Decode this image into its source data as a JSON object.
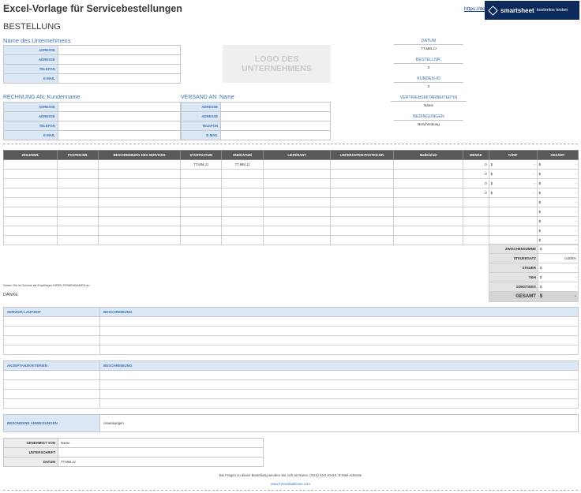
{
  "title": "Excel-Vorlage für Servicebestellungen",
  "link_text": "https://de",
  "banner": {
    "brand": "smartsheet",
    "cta": "kostenlos testen"
  },
  "heading": "BESTELLUNG",
  "company": {
    "name": "Name des Unternehmens",
    "rows": [
      {
        "label": "ADRESSE",
        "value": ""
      },
      {
        "label": "ADRESSE",
        "value": ""
      },
      {
        "label": "TELEFON",
        "value": ""
      },
      {
        "label": "E-MAIL",
        "value": ""
      }
    ]
  },
  "logo_text": "LOGO DES UNTERNEHMENS",
  "right_info": [
    {
      "label": "DATUM",
      "value": "TT.MM.JJ"
    },
    {
      "label": "BESTELLNR.",
      "value": "0"
    },
    {
      "label": "KUNDEN-ID",
      "value": "0"
    },
    {
      "label": "VERTRIEBSMITARBEITER*IN",
      "value": "Name"
    },
    {
      "label": "BEDINGUNGEN",
      "value": "Beschreibung"
    }
  ],
  "bill_to": {
    "label": "RECHNUNG AN:",
    "name": "Kundenname",
    "rows": [
      {
        "label": "ADRESSE",
        "value": ""
      },
      {
        "label": "ADRESSE",
        "value": ""
      },
      {
        "label": "TELEFON",
        "value": ""
      },
      {
        "label": "E-MAIL",
        "value": ""
      }
    ]
  },
  "ship_to": {
    "label": "VERSAND AN:",
    "name": "Name",
    "rows": [
      {
        "label": "ADRESSE",
        "value": ""
      },
      {
        "label": "ADRESSE",
        "value": ""
      },
      {
        "label": "TELEFON",
        "value": ""
      },
      {
        "label": "E-MAIL",
        "value": ""
      }
    ]
  },
  "items": {
    "columns": [
      "ZEILENNR.",
      "POSTEN-NR.",
      "BESCHREIBUNG DES SERVICES",
      "STARTDATUM",
      "ENDDATUM",
      "LIEFERANT",
      "LIEFERANTEN-POSTEN-NR.",
      "Maßeinheit",
      "MENGE",
      "TARIF",
      "GESAMT"
    ],
    "rows": [
      [
        "",
        "",
        "",
        "TT.MM.JJ",
        "TT.MM.JJ",
        "",
        "",
        "",
        "0",
        "$ -",
        "$ -"
      ],
      [
        "",
        "",
        "",
        "",
        "",
        "",
        "",
        "",
        "0",
        "$ -",
        "$ -"
      ],
      [
        "",
        "",
        "",
        "",
        "",
        "",
        "",
        "",
        "0",
        "$ -",
        "$ -"
      ],
      [
        "",
        "",
        "",
        "",
        "",
        "",
        "",
        "",
        "0",
        "$ -",
        "$ -"
      ],
      [
        "",
        "",
        "",
        "",
        "",
        "",
        "",
        "",
        "",
        "",
        "$ -"
      ],
      [
        "",
        "",
        "",
        "",
        "",
        "",
        "",
        "",
        "",
        "",
        "$ -"
      ],
      [
        "",
        "",
        "",
        "",
        "",
        "",
        "",
        "",
        "",
        "",
        "$ -"
      ],
      [
        "",
        "",
        "",
        "",
        "",
        "",
        "",
        "",
        "",
        "",
        "$ -"
      ],
      [
        "",
        "",
        "",
        "",
        "",
        "",
        "",
        "",
        "",
        "",
        "$ -"
      ]
    ]
  },
  "summary": [
    {
      "label": "ZWISCHENSUMME",
      "cur": "$",
      "value": "-"
    },
    {
      "label": "STEUERSATZ",
      "cur": "",
      "value": "0,000%"
    },
    {
      "label": "STEUER",
      "cur": "$",
      "value": "-"
    },
    {
      "label": "S&H",
      "cur": "$",
      "value": "-"
    },
    {
      "label": "SONSTIGES",
      "cur": "$",
      "value": "-"
    },
    {
      "label": "GESAMT",
      "cur": "$",
      "value": "-"
    }
  ],
  "check_note": "Geben Sie im Scheck als Empfänger IHREN FIRMENNAMEN an.",
  "thanks": "DANKE",
  "service_table": {
    "col1": "SERVICE-LAUFZEIT",
    "col2": "BESCHREIBUNG"
  },
  "acceptance_table": {
    "col1": "AKZEPTANZKRITERIEN",
    "col2": "BESCHREIBUNG"
  },
  "special": {
    "label": "BESONDERE ANWEISUNGEN",
    "value": "Anweisungen"
  },
  "approval": [
    {
      "label": "GENEHMIGT VON",
      "value": "Name"
    },
    {
      "label": "UNTERSCHRIFT",
      "value": ""
    },
    {
      "label": "DATUM",
      "value": "TT.MM.JJ"
    }
  ],
  "footer": {
    "question": "Bei Fragen zu dieser Bestellung wenden Sie sich an Name, (XXX) XXX-XXXX, E-Mail-Adresse",
    "website": "www.ihrewebadresse.com"
  }
}
